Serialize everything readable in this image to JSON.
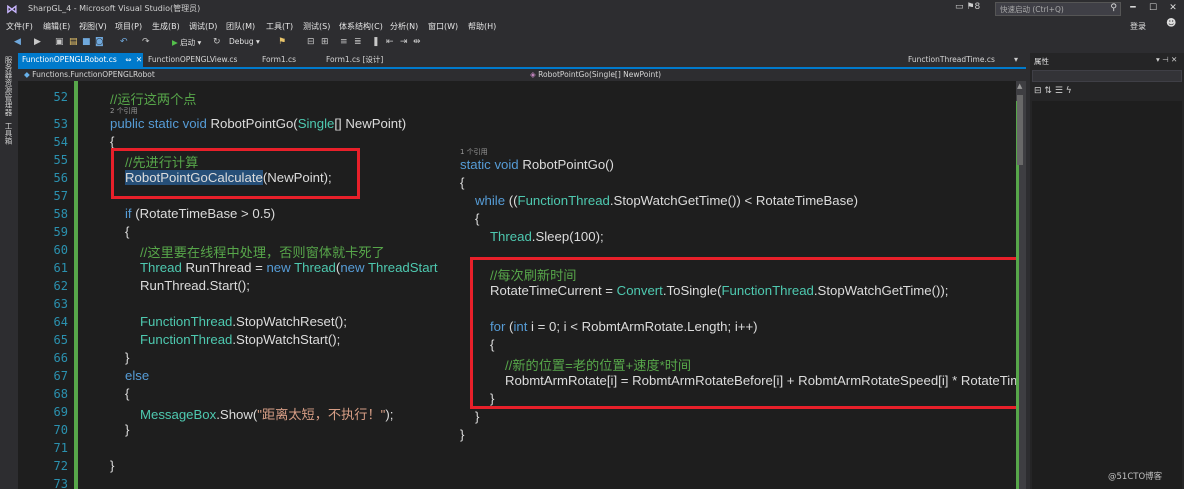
{
  "window": {
    "title": "SharpGL_4 - Microsoft Visual Studio(管理员)",
    "notification_count": "8",
    "quick_launch_placeholder": "快速启动 (Ctrl+Q)",
    "minimize": "━",
    "maximize": "☐",
    "close": "✕"
  },
  "menu": [
    "文件(F)",
    "编辑(E)",
    "视图(V)",
    "项目(P)",
    "生成(B)",
    "调试(D)",
    "团队(M)",
    "工具(T)",
    "测试(S)",
    "体系结构(C)",
    "分析(N)",
    "窗口(W)",
    "帮助(H)"
  ],
  "login_label": "登录",
  "toolbar": {
    "start_label": "启动",
    "configuration": "Debug"
  },
  "left_strip": {
    "server_explorer": "服务器资源管理器",
    "toolbox": "工具箱"
  },
  "tabs": [
    {
      "label": "FunctionOPENGLRobot.cs",
      "active": true,
      "pin": "⇔",
      "close": "✕"
    },
    {
      "label": "FunctionOPENGLView.cs"
    },
    {
      "label": "Form1.cs"
    },
    {
      "label": "Form1.cs [设计]"
    },
    {
      "label": "FunctionThreadTime.cs"
    }
  ],
  "nav": {
    "type_scope": "Functions.FunctionOPENGLRobot",
    "member_scope": "RobotPointGo(Single[] NewPoint)"
  },
  "editor": {
    "line_numbers": [
      "52",
      "53",
      "54",
      "55",
      "56",
      "57",
      "58",
      "59",
      "60",
      "61",
      "62",
      "63",
      "64",
      "65",
      "66",
      "67",
      "68",
      "69",
      "70",
      "71",
      "72",
      "73"
    ],
    "codelens": "2 个引用",
    "lines": {
      "l52_comment": "//运行这两个点",
      "l53_mod1": "public",
      "l53_mod2": "static",
      "l53_void": "void",
      "l53_name": " RobotPointGo(",
      "l53_type": "Single",
      "l53_rest": "[] NewPoint)",
      "l54": "{",
      "l55_comment": "//先进行计算",
      "l56_selected": "RobotPointGoCalculate",
      "l56_rest": "(NewPoint);",
      "l58_if": "if",
      "l58_rest": " (RotateTimeBase > 0.5)",
      "l59": "{",
      "l60_comment": "//这里要在线程中处理，否则窗体就卡死了",
      "l61_type": "Thread",
      "l61_mid": " RunThread = ",
      "l61_new": "new",
      "l61_type2": "Thread",
      "l61_paren": "(",
      "l61_new2": "new",
      "l61_type3": "ThreadStart",
      "l62": "RunThread.Start();",
      "l64_type": "FunctionThread",
      "l64_rest": ".StopWatchReset();",
      "l65_type": "FunctionThread",
      "l65_rest": ".StopWatchStart();",
      "l66": "}",
      "l67_else": "else",
      "l68": "{",
      "l69_type": "MessageBox",
      "l69_mid": ".Show(",
      "l69_str": "\"距离太短，不执行！\"",
      "l69_end": ");",
      "l70": "}",
      "l72": "}"
    }
  },
  "overlay": {
    "codelens": "1 个引用",
    "lines": {
      "o1_static": "static",
      "o1_void": "void",
      "o1_name": " RobotPointGo()",
      "o2": "{",
      "o3_while": "while",
      "o3_a": " ((",
      "o3_type": "FunctionThread",
      "o3_b": ".StopWatchGetTime()) < RotateTimeBase)",
      "o4": "{",
      "o5_type": "Thread",
      "o5_rest": ".Sleep(100);",
      "o6_comment": "//每次刷新时间",
      "o7_a": "RotateTimeCurrent = ",
      "o7_type": "Convert",
      "o7_b": ".ToSingle(",
      "o7_type2": "FunctionThread",
      "o7_c": ".StopWatchGetTime());",
      "o8_for": "for",
      "o8_a": " (",
      "o8_int": "int",
      "o8_b": " i = 0; i < RobmtArmRotate.Length; i++)",
      "o9": "{",
      "o10_comment": "//新的位置=老的位置+速度*时间",
      "o11": "RobmtArmRotate[i] = RobmtArmRotateBefore[i] + RobmtArmRotateSpeed[i] * RotateTimeCurrent;",
      "o12": "}",
      "o13": "}",
      "o14": "}"
    }
  },
  "properties": {
    "title": "属性",
    "pin": "▾ ⊣",
    "close": "✕"
  },
  "watermark": "@51CTO博客",
  "colors": {
    "keyword": "#569cd6",
    "type": "#4ec9b0",
    "comment": "#57a64a",
    "string": "#d69d85",
    "line_number": "#2b91af",
    "accent": "#007acc",
    "highlight_box": "#e8202a"
  }
}
